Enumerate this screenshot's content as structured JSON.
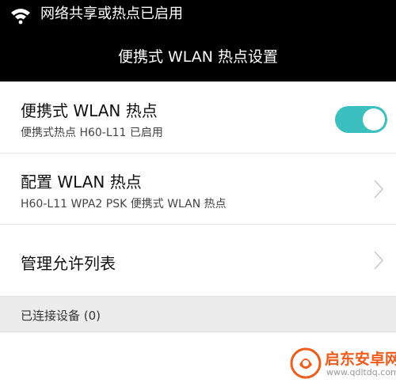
{
  "status_bar": {
    "icon": "wifi-hotspot-icon",
    "text": "网络共享或热点已启用"
  },
  "header": {
    "title": "便携式 WLAN 热点设置"
  },
  "rows": [
    {
      "title": "便携式 WLAN 热点",
      "subtitle": "便携式热点 H60-L11 已启用",
      "control": "toggle",
      "toggle_on": true
    },
    {
      "title": "配置 WLAN 热点",
      "subtitle": "H60-L11 WPA2 PSK 便携式 WLAN 热点",
      "control": "chevron-right-icon"
    },
    {
      "title": "管理允许列表",
      "control": "chevron-right-icon"
    }
  ],
  "section": {
    "label": "已连接设备 (0)"
  },
  "colors": {
    "toggle_on": "#3bbfbf",
    "header_bg": "#000000",
    "section_bg": "#ececec"
  },
  "watermark": {
    "title": "启东安卓网",
    "url": "www.qdltdq.com",
    "icon": "watermark-logo-icon"
  }
}
